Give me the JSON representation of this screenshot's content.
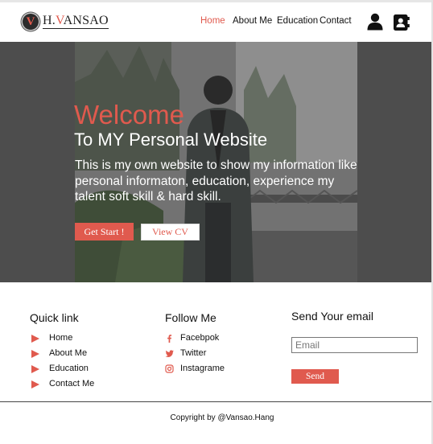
{
  "brand": {
    "letter": "V",
    "name_prefix": "H.",
    "name_accent": "V",
    "name_rest": "ANSAO"
  },
  "nav": {
    "home": "Home",
    "about": "About Me",
    "education": "Education",
    "contact": "Contact"
  },
  "header_icons": [
    "user-icon",
    "contact-book-icon"
  ],
  "hero": {
    "title": "Welcome",
    "subtitle": "To MY Personal Website",
    "description": "This is my own website to show my information like  personal informaton, education, experience my talent soft skill & hard skill.",
    "primary_button": "Get Start !",
    "secondary_button": "View CV"
  },
  "quick_links": {
    "title": "Quick link",
    "items": [
      "Home",
      "About Me",
      "Education",
      "Contact Me"
    ]
  },
  "follow": {
    "title": "Follow Me",
    "items": [
      {
        "label": "Facebpok",
        "icon": "facebook-icon"
      },
      {
        "label": "Twitter",
        "icon": "twitter-icon"
      },
      {
        "label": "Instagrame",
        "icon": "instagram-icon"
      }
    ]
  },
  "email": {
    "title": "Send Your email",
    "placeholder": "Email",
    "button": "Send"
  },
  "copyright": "Copyright by @Vansao.Hang",
  "colors": {
    "accent": "#e05a4e",
    "hero_bg": "#4d4d4d"
  }
}
